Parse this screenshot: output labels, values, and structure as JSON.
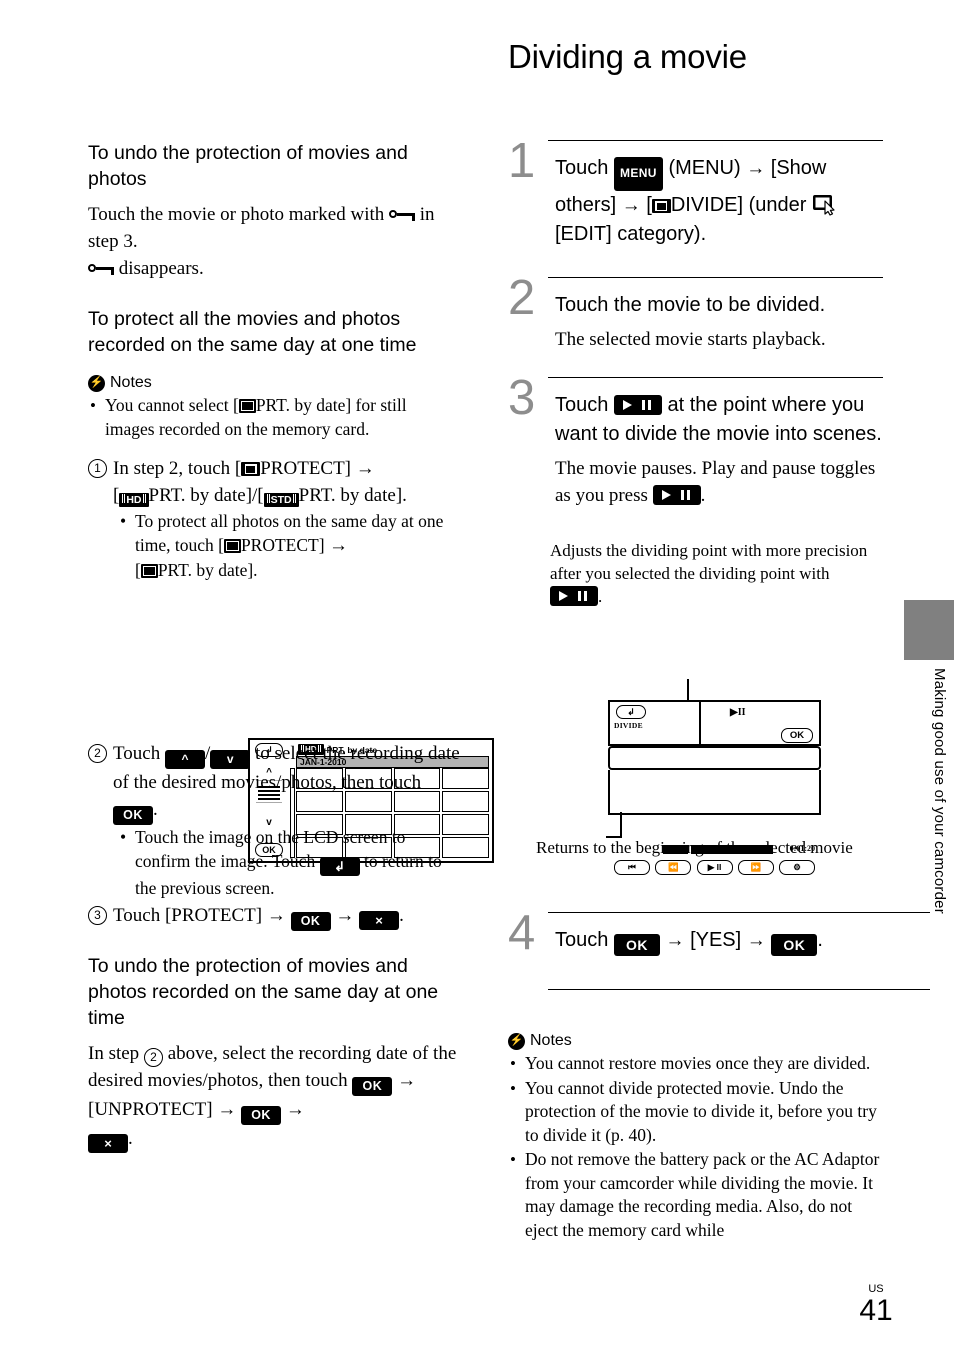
{
  "page": {
    "title": "Dividing a movie",
    "folio_label": "US",
    "folio_number": "41",
    "side_tab_text": "Making good use of your camcorder",
    "tab_color": "#808080",
    "step_number_color": "#8d8d8d"
  },
  "left_column": {
    "section1": {
      "heading": "To undo the protection of movies and photos",
      "para1_a": "Touch the movie or photo marked with",
      "para1_b": "in step 3.",
      "para2": "disappears."
    },
    "section2": {
      "heading": "To protect all the movies and photos recorded on the same day at one time",
      "notes_label": "Notes",
      "notes": [
        {
          "before": "You cannot select [",
          "icon": "photo-icon",
          "after": "PRT. by date] for still images recorded on the memory card."
        }
      ],
      "steps": [
        {
          "num": "1",
          "text_a": "In step 2, touch [",
          "icon_a": "movie-icon",
          "text_b": "PROTECT]",
          "arrow": "→",
          "text_c": "[",
          "icon_b": "hd-badge",
          "text_d": "PRT. by date]/[",
          "icon_c": "std-badge",
          "text_e": "PRT. by date].",
          "sub": {
            "text_a": "To protect all photos on the same day at one time, touch [",
            "icon_a": "photo-icon",
            "text_b": "PROTECT]",
            "text_c": "[",
            "icon_b": "photo-icon",
            "text_d": "PRT. by date]."
          }
        },
        {
          "num": "2",
          "text_a": "Touch",
          "btn_up": "up-chevron-button",
          "sep": "/",
          "btn_down": "down-chevron-button",
          "text_b": "to select the recording date of the desired movies/photos, then touch",
          "btn_ok": "OK",
          "text_c": ".",
          "sub": {
            "text_a": "Touch the image on the LCD screen to confirm the image. Touch",
            "btn_back": "back-button",
            "text_b": "to return to the previous screen."
          }
        },
        {
          "num": "3",
          "text_a": "Touch [PROTECT]",
          "btn_ok": "OK",
          "btn_x": "×",
          "text_b": "."
        }
      ],
      "lcd_screen": {
        "name": "protect-by-date-screen",
        "back_button": "↶",
        "header_badge": "HD",
        "header_text": "PRT. by date",
        "date_bar": "JAN-1-2010",
        "up_chevron": "⌃",
        "down_chevron": "⌄",
        "ok_button": "OK",
        "thumbnail_count": 16
      }
    },
    "section3": {
      "heading": "To undo the protection of movies and photos recorded on the same day at one time",
      "text_a": "In step",
      "circle_num": "2",
      "text_b": "above, select the recording date of the desired movies/photos, then touch",
      "btn_ok1": "OK",
      "text_c": "[UNPROTECT]",
      "btn_ok2": "OK",
      "btn_x": "×",
      "text_d": "."
    }
  },
  "right_column": {
    "steps": [
      {
        "num": "1",
        "text_a": "Touch",
        "menu_badge": "MENU",
        "text_b": "(MENU)",
        "text_c": "[Show others]",
        "text_d": "[",
        "icon": "movie-icon",
        "text_e": "DIVIDE] (under",
        "text_f": "[EDIT] category)."
      },
      {
        "num": "2",
        "text": "Touch the movie to be divided.",
        "sub": "The selected movie starts playback."
      },
      {
        "num": "3",
        "text_a": "Touch",
        "play_button": "play-pause-button",
        "text_b": "at the point where you want to divide the movie into scenes.",
        "sub_a": "The movie pauses. Play and pause toggles as you press",
        "sub_b": "."
      },
      {
        "num": "4",
        "text_a": "Touch",
        "btn_ok1": "OK",
        "text_b": "[YES]",
        "btn_ok2": "OK",
        "text_c": "."
      }
    ],
    "callout_top": {
      "text_a": "Adjusts the dividing point with more precision after you selected the dividing point with",
      "text_b": "."
    },
    "callout_bottom": "Returns to the beginning of the selected movie",
    "lcd_screen": {
      "name": "divide-screen",
      "back_button": "↶",
      "divide_label": "DIVIDE",
      "play_pause_indicator": "▶II",
      "ok_button": "OK",
      "frame_back_button": "◀II",
      "frame_forward_button": "II▶",
      "timecode": "0:01:20",
      "bottom_buttons": [
        "return-to-start-button",
        "frame-reverse-button",
        "play-pause-button",
        "frame-advance-button",
        "options-button"
      ]
    },
    "notes": {
      "label": "Notes",
      "items": [
        "You cannot restore movies once they are divided.",
        "You cannot divide protected movie. Undo the protection of the movie to divide it, before you try to divide it (p. 40).",
        "Do not remove the battery pack or the AC Adaptor from your camcorder while dividing the movie. It may damage the recording media. Also, do not eject the memory card while"
      ]
    }
  }
}
